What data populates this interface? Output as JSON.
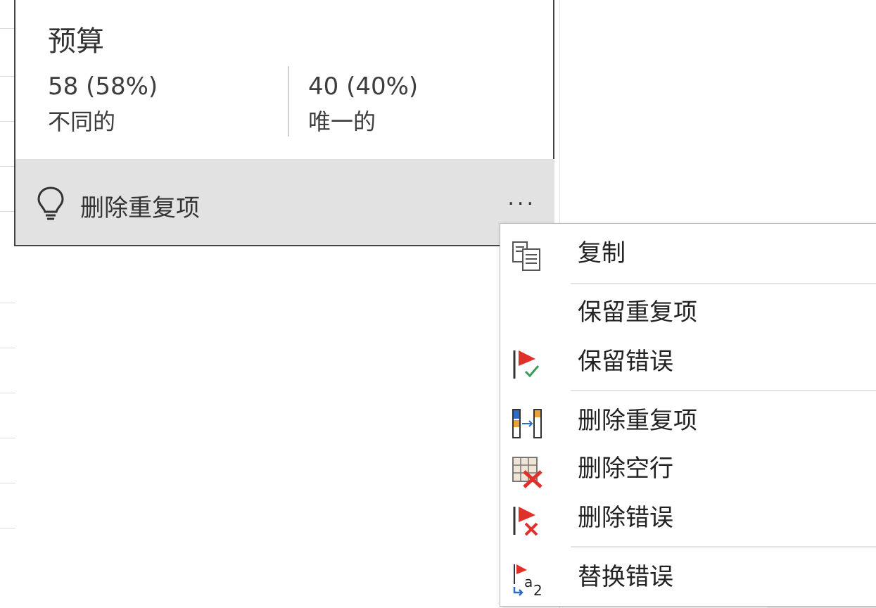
{
  "card": {
    "title": "预算",
    "distinct": {
      "value": "58 (58%)",
      "label": "不同的"
    },
    "unique": {
      "value": "40 (40%)",
      "label": "唯一的"
    },
    "action": {
      "label": "删除重复项",
      "more": "..."
    }
  },
  "menu": {
    "items": [
      {
        "label": "复制",
        "icon": "copy-icon"
      },
      {
        "label": "保留重复项",
        "icon": ""
      },
      {
        "label": "保留错误",
        "icon": "keep-errors-icon"
      },
      {
        "label": "删除重复项",
        "icon": "remove-duplicates-icon"
      },
      {
        "label": "删除空行",
        "icon": "remove-empty-icon"
      },
      {
        "label": "删除错误",
        "icon": "remove-errors-icon"
      },
      {
        "label": "替换错误",
        "icon": "replace-errors-icon"
      }
    ]
  },
  "colors": {
    "flag_red": "#e0302a",
    "check_green": "#3a9a5a",
    "accent_blue": "#2b6cc4",
    "bar_gold": "#e8a23a"
  }
}
